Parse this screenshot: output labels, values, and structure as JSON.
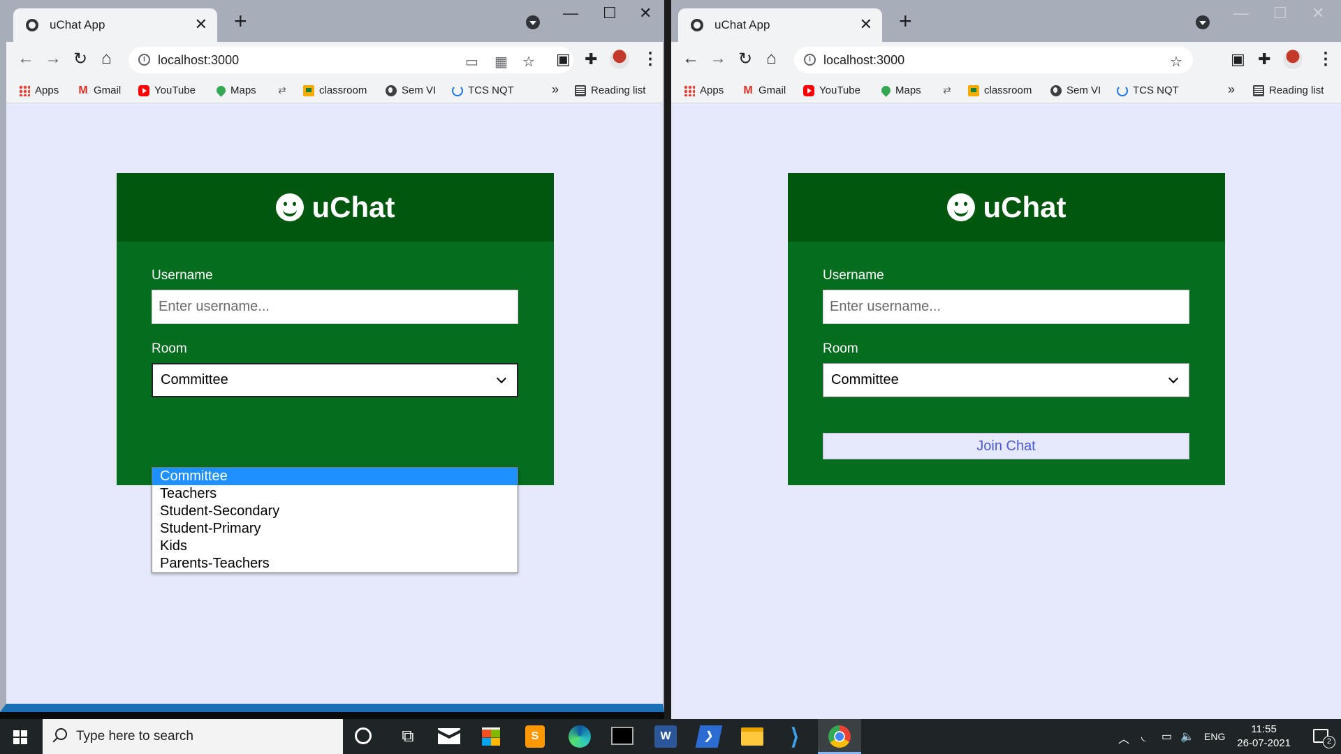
{
  "browser": {
    "tab_title": "uChat App",
    "tab_close": "✕",
    "new_tab": "+",
    "url": "localhost:3000",
    "bookmarks": [
      "Apps",
      "Gmail",
      "YouTube",
      "Maps",
      "classroom",
      "Sem VI",
      "TCS NQT"
    ],
    "bookmarks_more": "»",
    "reading_list": "Reading list",
    "controls": {
      "minimize": "—",
      "maximize": "☐",
      "close": "✕"
    }
  },
  "app": {
    "brand": "uChat",
    "username_label": "Username",
    "username_placeholder": "Enter username...",
    "room_label": "Room",
    "room_selected": "Committee",
    "room_options": [
      "Committee",
      "Teachers",
      "Student-Secondary",
      "Student-Primary",
      "Kids",
      "Parents-Teachers"
    ],
    "join_button": "Join Chat"
  },
  "taskbar": {
    "search_placeholder": "Type here to search",
    "language": "ENG",
    "time": "11:55",
    "date": "26-07-2021",
    "notification_count": "2",
    "apps": [
      "cortana-icon",
      "task-view-icon",
      "mail-icon",
      "store-icon",
      "sublime-icon",
      "edge-icon",
      "terminal-icon",
      "word-icon",
      "powershell-icon",
      "file-explorer-icon",
      "vscode-icon",
      "chrome-icon"
    ]
  },
  "colors": {
    "header_green": "#02570f",
    "card_green": "#046d1e",
    "page_bg": "#e6e8fc",
    "option_highlight": "#1e90ff",
    "button_text": "#4a5ad2"
  }
}
